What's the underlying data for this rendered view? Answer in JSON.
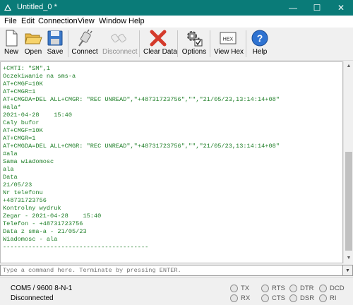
{
  "window": {
    "title": "Untitled_0 *",
    "controls": {
      "minimize": "—",
      "maximize": "☐",
      "close": "✕"
    }
  },
  "menu": [
    "File",
    "Edit",
    "Connection",
    "View",
    "Window",
    "Help"
  ],
  "toolbar": {
    "new": "New",
    "open": "Open",
    "save": "Save",
    "connect": "Connect",
    "disconnect": "Disconnect",
    "clear": "Clear Data",
    "options": "Options",
    "view_hex": "View Hex",
    "help": "Help",
    "hex_icon_text": "HEX",
    "help_icon_text": "?"
  },
  "terminal": {
    "lines": [
      "+CMTI: \"SM\",1",
      "Oczekiwanie na sms-a",
      "AT+CMGF=10K",
      "AT+CMGR=1",
      "AT+CMGDA=DEL ALL+CMGR: \"REC UNREAD\",\"+48731723756\",\"\",\"21/05/23,13:14:14+08\"",
      "#ala*",
      "2021-04-28    15:40",
      "Caly bufor",
      "AT+CMGF=10K",
      "AT+CMGR=1",
      "AT+CMGDA=DEL ALL+CMGR: \"REC UNREAD\",\"+48731723756\",\"\",\"21/05/23,13:14:14+08\"",
      "#ala",
      "Sama wiadomosc",
      "ala",
      "Data",
      "21/05/23",
      "Nr telefonu",
      "+48731723756",
      "Kontrolny wydruk",
      "Zegar - 2021-04-28    15:40",
      "Telefon - +48731723756",
      "Data z sma-a - 21/05/23",
      "Wiadomosc - ala",
      "----------------------------------------"
    ]
  },
  "command": {
    "placeholder": "Type a command here. Terminate by pressing ENTER."
  },
  "status": {
    "port": "COM5 / 9600 8-N-1",
    "state": "Disconnected",
    "indicators": [
      "TX",
      "RX",
      "RTS",
      "CTS",
      "DTR",
      "DSR",
      "DCD",
      "RI"
    ]
  }
}
